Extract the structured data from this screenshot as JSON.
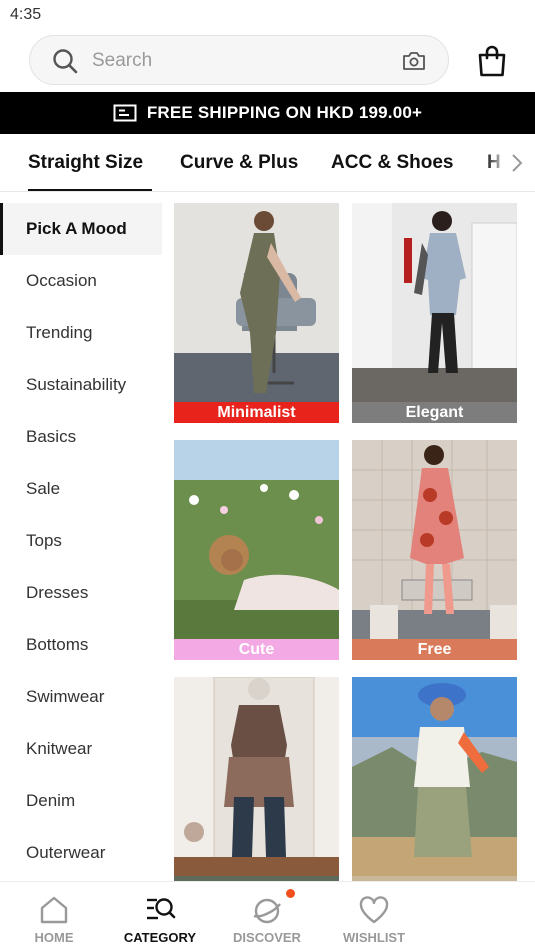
{
  "status_bar": {
    "time": "4:35"
  },
  "search": {
    "placeholder": "Search"
  },
  "banner": {
    "text": "FREE SHIPPING ON HKD 199.00+"
  },
  "tabs": [
    {
      "label": "Straight Size",
      "active": true
    },
    {
      "label": "Curve & Plus",
      "active": false
    },
    {
      "label": "ACC & Shoes",
      "active": false
    },
    {
      "label": "H",
      "active": false
    }
  ],
  "sidebar": {
    "items": [
      {
        "label": "Pick A Mood",
        "active": true
      },
      {
        "label": "Occasion"
      },
      {
        "label": "Trending"
      },
      {
        "label": "Sustainability"
      },
      {
        "label": "Basics"
      },
      {
        "label": "Sale"
      },
      {
        "label": "Tops"
      },
      {
        "label": "Dresses"
      },
      {
        "label": "Bottoms"
      },
      {
        "label": "Swimwear"
      },
      {
        "label": "Knitwear"
      },
      {
        "label": "Denim"
      },
      {
        "label": "Outerwear"
      }
    ]
  },
  "moods": [
    {
      "label": "Minimalist",
      "caption_color": "#e8231c"
    },
    {
      "label": "Elegant",
      "caption_color": "#7d7d7d"
    },
    {
      "label": "Cute",
      "caption_color": "#f3a9e4"
    },
    {
      "label": "Free",
      "caption_color": "#d97b5a"
    },
    {
      "label": "",
      "caption_color": "#5e6b5a"
    },
    {
      "label": "",
      "caption_color": "#c9b79a"
    }
  ],
  "bottom_nav": [
    {
      "label": "HOME",
      "icon": "home-icon",
      "active": false
    },
    {
      "label": "CATEGORY",
      "icon": "category-icon",
      "active": true
    },
    {
      "label": "DISCOVER",
      "icon": "discover-icon",
      "active": false
    },
    {
      "label": "WISHLIST",
      "icon": "heart-icon",
      "active": false
    }
  ],
  "colors": {
    "accent": "#000000",
    "badge": "#f24e1e"
  }
}
